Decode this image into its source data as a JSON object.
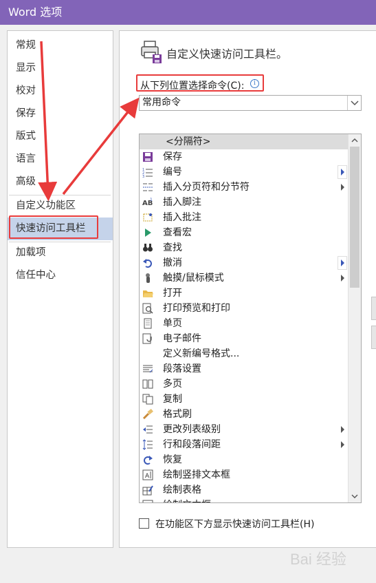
{
  "window": {
    "title": "Word 选项"
  },
  "sidebar": {
    "items": [
      {
        "label": "常规"
      },
      {
        "label": "显示"
      },
      {
        "label": "校对"
      },
      {
        "label": "保存"
      },
      {
        "label": "版式"
      },
      {
        "label": "语言"
      },
      {
        "label": "高级"
      },
      {
        "label": "自定义功能区"
      },
      {
        "label": "快速访问工具栏",
        "selected": true
      },
      {
        "label": "加载项"
      },
      {
        "label": "信任中心"
      }
    ]
  },
  "main": {
    "header_title": "自定义快速访问工具栏。",
    "choose_commands_label": "从下列位置选择命令(C):",
    "combo_value": "常用命令",
    "commands": [
      {
        "label": "<分隔符>",
        "icon": "separator",
        "selected": true
      },
      {
        "label": "保存",
        "icon": "save-icon"
      },
      {
        "label": "编号",
        "icon": "numbering-icon",
        "submenu": "boxed"
      },
      {
        "label": "插入分页符和分节符",
        "icon": "page-break-icon",
        "submenu": "plain"
      },
      {
        "label": "插入脚注",
        "icon": "footnote-icon"
      },
      {
        "label": "插入批注",
        "icon": "comment-icon"
      },
      {
        "label": "查看宏",
        "icon": "play-macro-icon"
      },
      {
        "label": "查找",
        "icon": "binoculars-icon"
      },
      {
        "label": "撤消",
        "icon": "undo-icon",
        "submenu": "boxed"
      },
      {
        "label": "触摸/鼠标模式",
        "icon": "touch-icon",
        "submenu": "plain"
      },
      {
        "label": "打开",
        "icon": "open-folder-icon"
      },
      {
        "label": "打印预览和打印",
        "icon": "print-preview-icon"
      },
      {
        "label": "单页",
        "icon": "one-page-icon"
      },
      {
        "label": "电子邮件",
        "icon": "email-icon"
      },
      {
        "label": "定义新编号格式...",
        "icon": "none"
      },
      {
        "label": "段落设置",
        "icon": "paragraph-icon"
      },
      {
        "label": "多页",
        "icon": "multi-page-icon"
      },
      {
        "label": "复制",
        "icon": "copy-icon"
      },
      {
        "label": "格式刷",
        "icon": "format-painter-icon"
      },
      {
        "label": "更改列表级别",
        "icon": "list-level-icon",
        "submenu": "plain"
      },
      {
        "label": "行和段落间距",
        "icon": "line-spacing-icon",
        "submenu": "plain"
      },
      {
        "label": "恢复",
        "icon": "redo-icon"
      },
      {
        "label": "绘制竖排文本框",
        "icon": "vertical-textbox-icon"
      },
      {
        "label": "绘制表格",
        "icon": "draw-table-icon"
      },
      {
        "label": "绘制文本框",
        "icon": "textbox-icon"
      }
    ],
    "show_below_ribbon_label": "在功能区下方显示快速访问工具栏(H)"
  },
  "watermark": {
    "brand": "Bai 经验"
  },
  "colors": {
    "titlebar": "#8264b8",
    "highlight": "#e83b3b",
    "selected_nav": "#c5d3ea"
  }
}
